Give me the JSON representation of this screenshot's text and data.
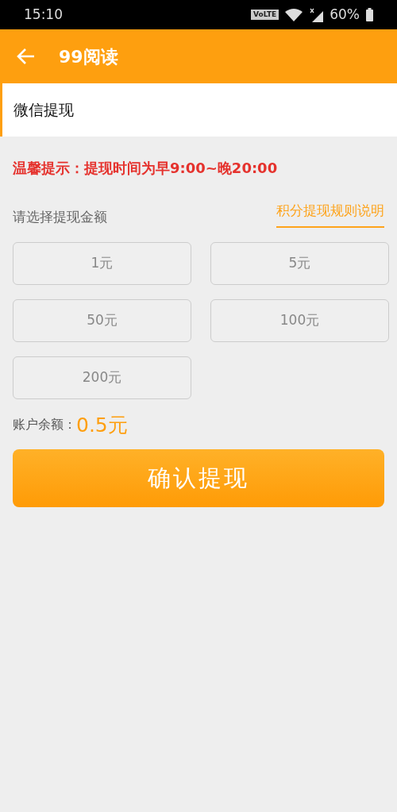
{
  "status_bar": {
    "time": "15:10",
    "network_badge": "VoLTE",
    "battery": "60%"
  },
  "header": {
    "title": "99阅读"
  },
  "tabs": [
    {
      "label": "微信提现",
      "selected": true
    }
  ],
  "notice": "温馨提示：提现时间为早9:00~晚20:00",
  "amount_prompt": "请选择提现金额",
  "rules_link": "积分提现规则说明",
  "amounts": [
    {
      "label": "1元",
      "selected": false
    },
    {
      "label": "5元",
      "selected": false
    },
    {
      "label": "50元",
      "selected": false
    },
    {
      "label": "100元",
      "selected": false
    },
    {
      "label": "200元",
      "selected": false
    }
  ],
  "balance": {
    "label": "账户余额：",
    "value": "0.5元"
  },
  "confirm_button": "确认提现"
}
